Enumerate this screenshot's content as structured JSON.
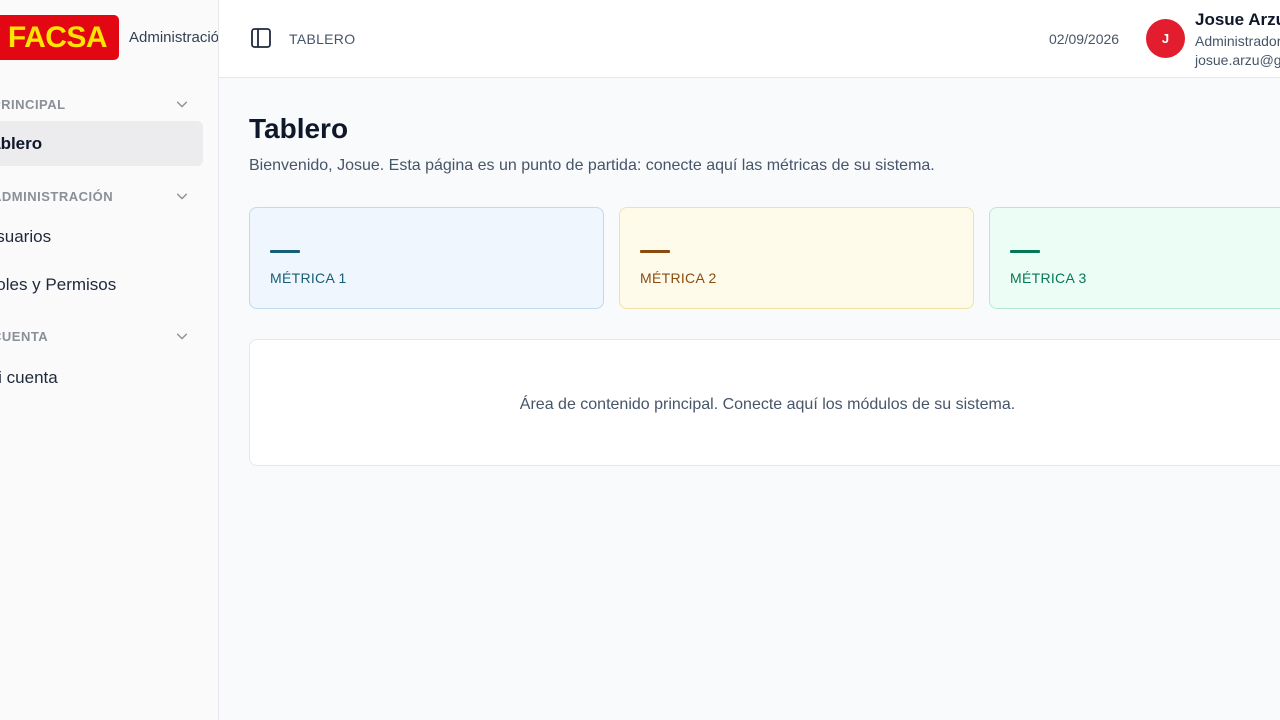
{
  "brand": {
    "logo_text": "FACSA",
    "subtitle": "Administración"
  },
  "sidebar": {
    "sections": [
      {
        "label": "PRINCIPAL",
        "items": [
          {
            "label": "Tablero",
            "active": true
          }
        ]
      },
      {
        "label": "ADMINISTRACIÓN",
        "items": [
          {
            "label": "Usuarios"
          },
          {
            "label": "Roles y Permisos"
          }
        ]
      },
      {
        "label": "CUENTA",
        "items": [
          {
            "label": "Mi cuenta"
          }
        ]
      }
    ]
  },
  "header": {
    "breadcrumb": "TABLERO",
    "date": "02/09/2026",
    "user": {
      "initial": "J",
      "name": "Josue Arzu",
      "role": "Administrador",
      "email": "josue.arzu@gmail.com"
    }
  },
  "main": {
    "title": "Tablero",
    "description": "Bienvenido, Josue. Esta página es un punto de partida: conecte aquí las métricas de su sistema.",
    "metrics": [
      {
        "label": "MÉTRICA 1",
        "bg": "#eff6fd",
        "border": "#bfdbea",
        "accent": "#155e75"
      },
      {
        "label": "MÉTRICA 2",
        "bg": "#fefbea",
        "border": "#f2e2a4",
        "accent": "#8a4b0f"
      },
      {
        "label": "MÉTRICA 3",
        "bg": "#ecfdf5",
        "border": "#b4ead2",
        "accent": "#047857"
      }
    ],
    "content_placeholder": "Área de contenido principal. Conecte aquí los módulos de su sistema."
  },
  "colors": {
    "brand_red": "#e30613",
    "brand_yellow": "#ffe500",
    "avatar_bg": "#e11d2e"
  }
}
